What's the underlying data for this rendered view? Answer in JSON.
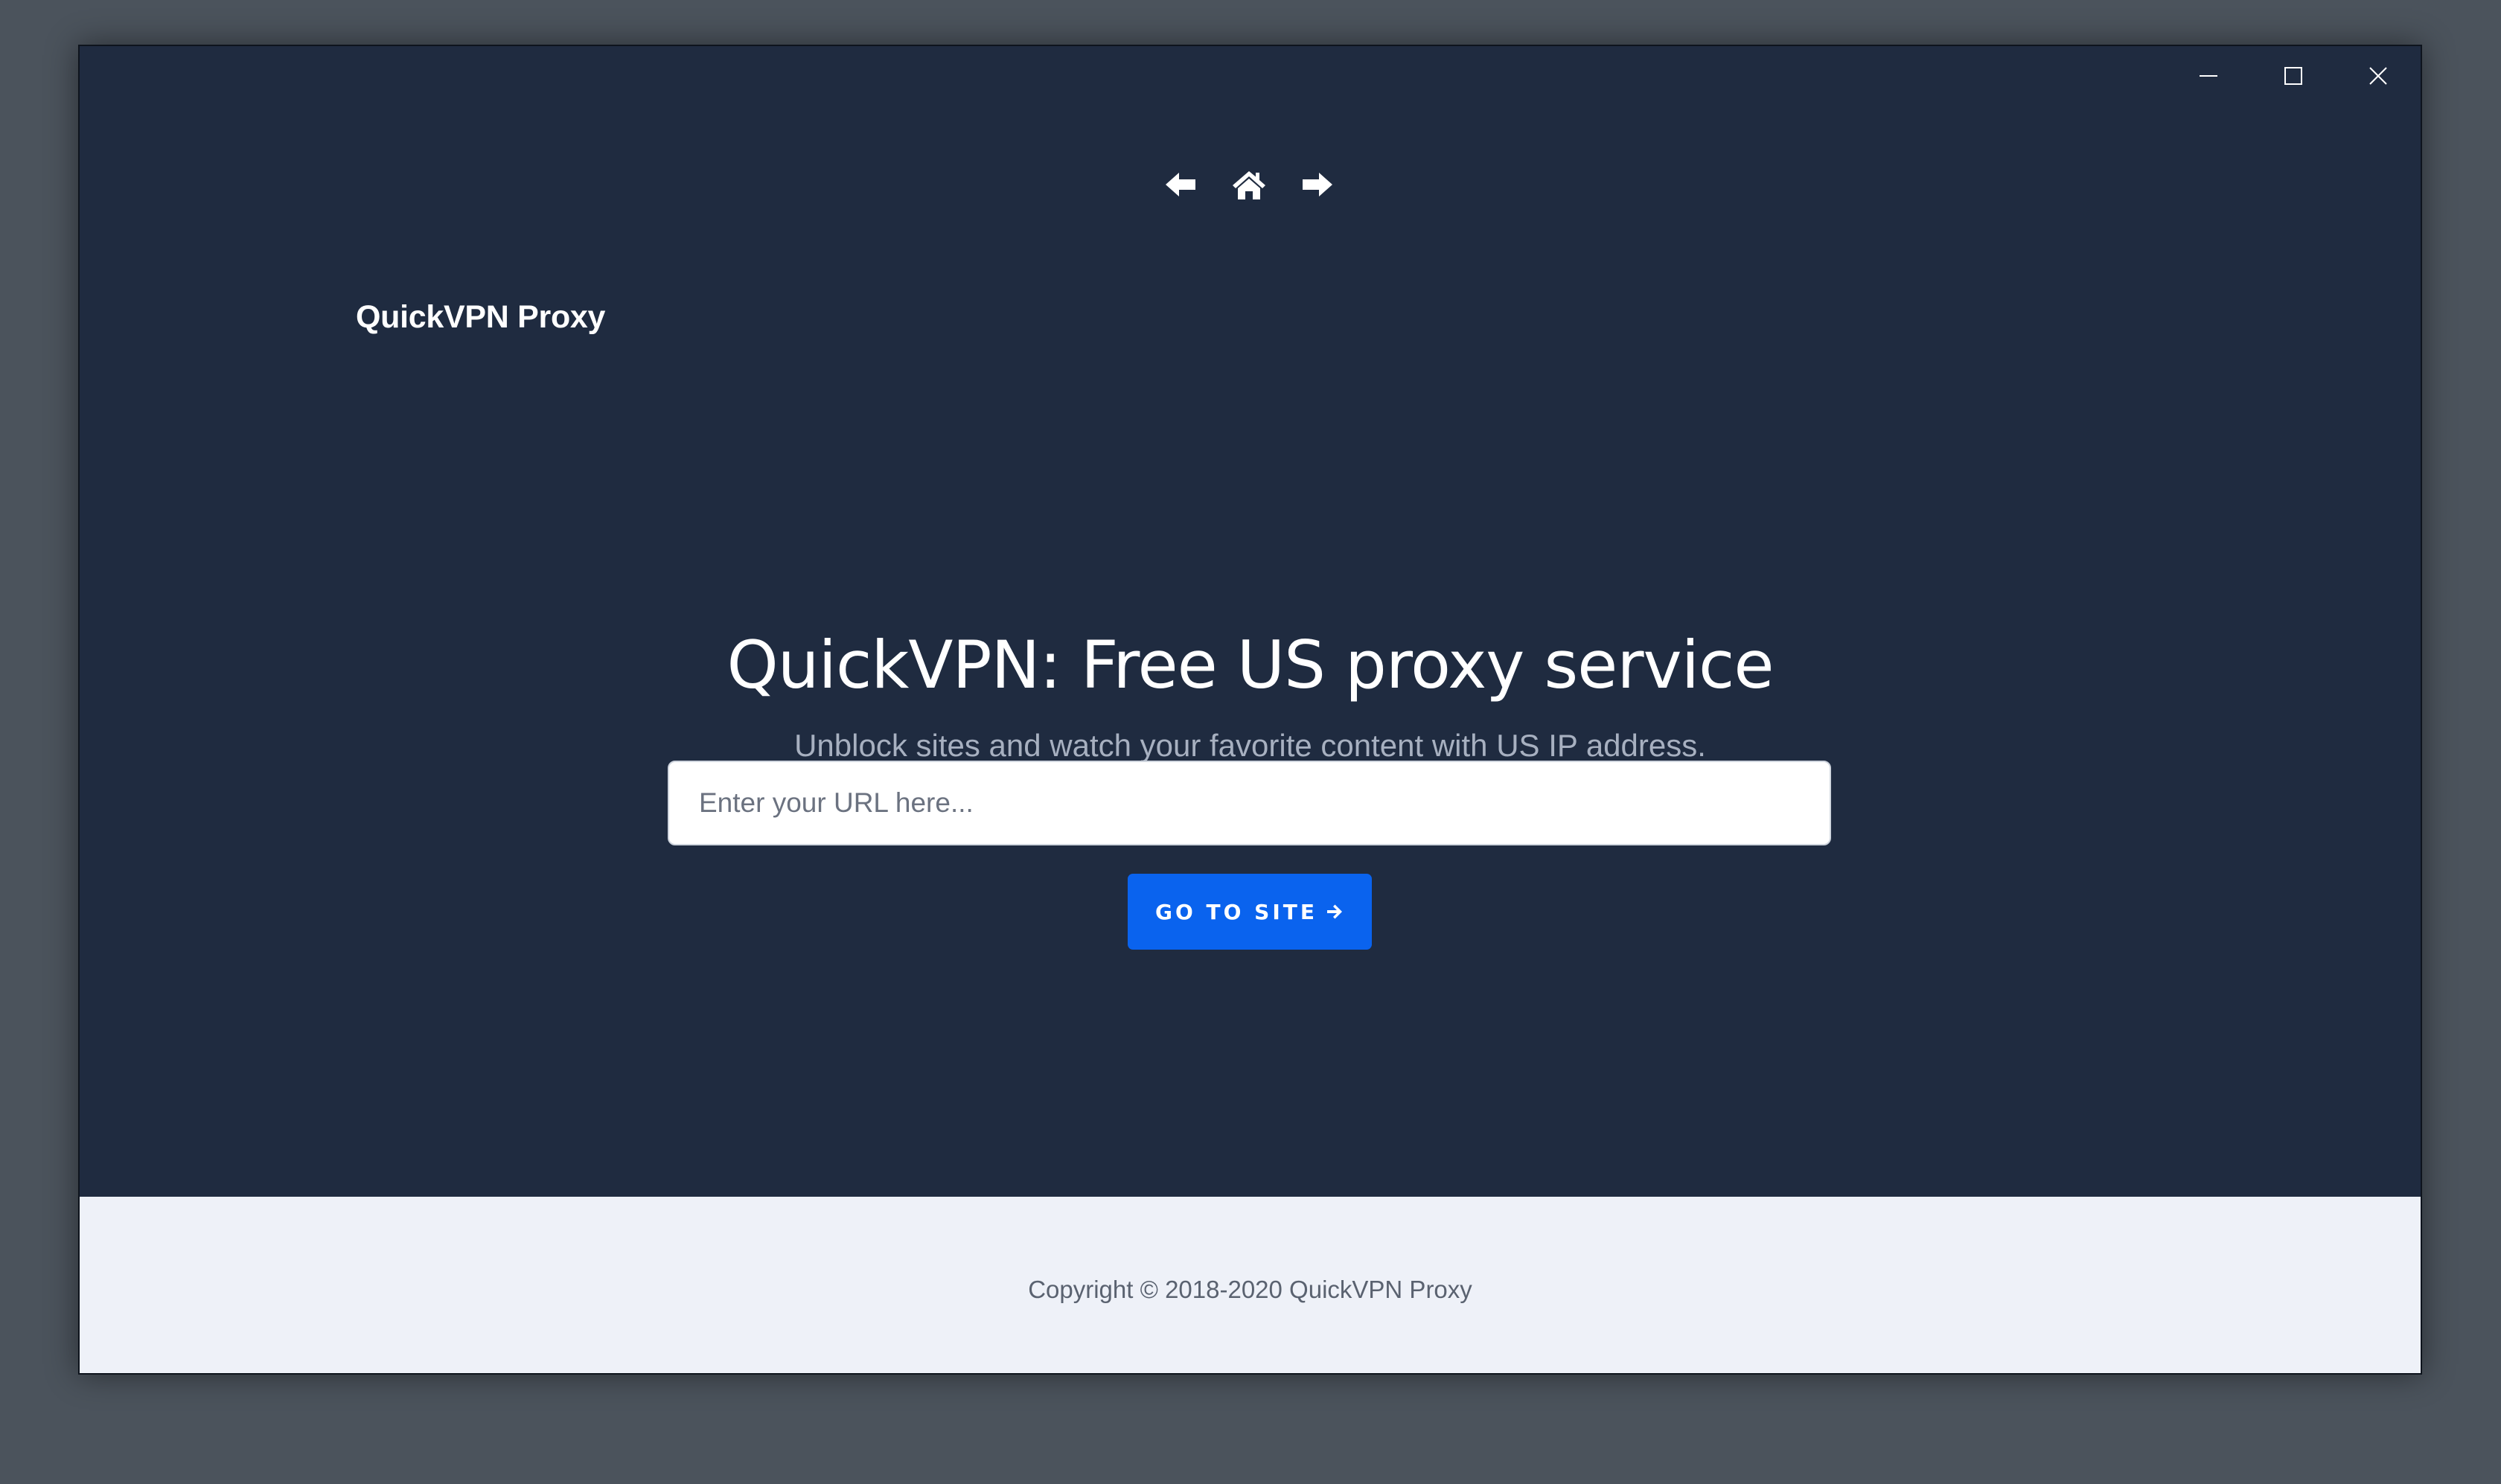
{
  "window": {
    "controls": {
      "minimize_icon": "minimize-icon",
      "maximize_icon": "maximize-icon",
      "close_icon": "close-icon"
    }
  },
  "nav": {
    "back_icon": "arrow-left-icon",
    "home_icon": "home-icon",
    "forward_icon": "arrow-right-icon"
  },
  "brand": {
    "name": "QuickVPN Proxy"
  },
  "hero": {
    "title": "QuickVPN: Free US proxy service",
    "subtitle": "Unblock sites and watch your favorite content with US IP address."
  },
  "form": {
    "url_placeholder": "Enter your URL here...",
    "url_value": "",
    "submit_label": "GO TO SITE",
    "submit_icon": "arrow-right-icon"
  },
  "footer": {
    "copyright": "Copyright © 2018-2020 QuickVPN Proxy"
  },
  "colors": {
    "background": "#1f2b40",
    "accent": "#0a63ee",
    "footer_bg": "#eef1f8",
    "desktop": "#4b535c"
  }
}
